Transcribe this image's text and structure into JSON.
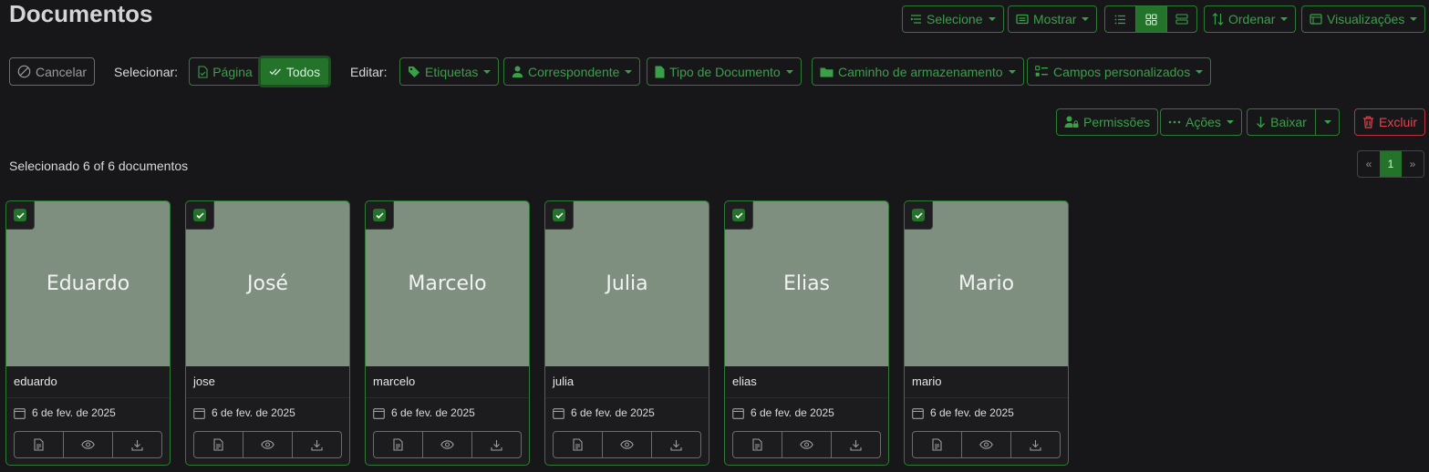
{
  "page": {
    "title": "Documentos"
  },
  "toolbar": {
    "select_label": "Selecione",
    "show_label": "Mostrar",
    "sort_label": "Ordenar",
    "views_label": "Visualizações"
  },
  "bulk": {
    "cancel_label": "Cancelar",
    "select_prefix": "Selecionar:",
    "page_label": "Página",
    "all_label": "Todos",
    "edit_prefix": "Editar:",
    "tags_label": "Etiquetas",
    "correspondent_label": "Correspondente",
    "doctype_label": "Tipo de Documento",
    "storage_label": "Caminho de armazenamento",
    "custom_fields_label": "Campos personalizados",
    "permissions_label": "Permissões",
    "actions_label": "Ações",
    "download_label": "Baixar",
    "delete_label": "Excluir"
  },
  "status": {
    "text": "Selecionado 6 of 6 documentos"
  },
  "pagination": {
    "prev": "«",
    "current": "1",
    "next": "»"
  },
  "colors": {
    "accent": "#23742a",
    "accent_text": "#3aa048",
    "danger": "#e0444e",
    "thumb_bg": "#7e8f7f",
    "background": "#17171a"
  },
  "documents": [
    {
      "thumb_text": "Eduardo",
      "title": "eduardo",
      "date": "6 de fev. de 2025"
    },
    {
      "thumb_text": "José",
      "title": "jose",
      "date": "6 de fev. de 2025"
    },
    {
      "thumb_text": "Marcelo",
      "title": "marcelo",
      "date": "6 de fev. de 2025"
    },
    {
      "thumb_text": "Julia",
      "title": "julia",
      "date": "6 de fev. de 2025"
    },
    {
      "thumb_text": "Elias",
      "title": "elias",
      "date": "6 de fev. de 2025"
    },
    {
      "thumb_text": "Mario",
      "title": "mario",
      "date": "6 de fev. de 2025"
    }
  ]
}
